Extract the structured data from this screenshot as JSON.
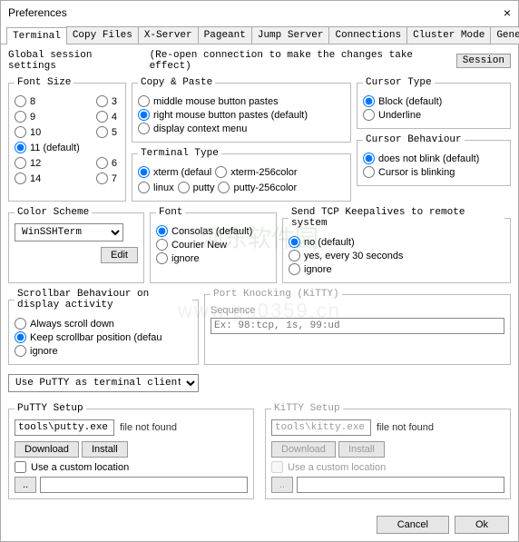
{
  "window": {
    "title": "Preferences",
    "close": "×"
  },
  "tabs": [
    "Terminal",
    "Copy Files",
    "X-Server",
    "Pageant",
    "Jump Server",
    "Connections",
    "Cluster Mode",
    "General"
  ],
  "activeTab": 0,
  "subtitle": {
    "label": "Global session settings",
    "hint": "(Re-open connection to make the changes take effect)",
    "sessionBtn": "Session"
  },
  "fontSize": {
    "legend": "Font Size",
    "left": [
      "8",
      "9",
      "10",
      "11 (default)",
      "12",
      "14"
    ],
    "right": [
      "3",
      "4",
      "5",
      "",
      "6",
      "7"
    ],
    "selected": "11 (default)"
  },
  "copyPaste": {
    "legend": "Copy & Paste",
    "options": [
      "middle mouse button pastes",
      "right mouse button pastes (default)",
      "display context menu"
    ],
    "selected": 1
  },
  "cursorType": {
    "legend": "Cursor Type",
    "options": [
      "Block (default)",
      "Underline"
    ],
    "selected": 0
  },
  "terminalType": {
    "legend": "Terminal Type",
    "row1": [
      "xterm (defaul",
      "xterm-256color"
    ],
    "row2": [
      "linux",
      "putty",
      "putty-256color"
    ],
    "selected": "xterm (defaul"
  },
  "cursorBehaviour": {
    "legend": "Cursor Behaviour",
    "options": [
      "does not blink (default)",
      "Cursor is blinking"
    ],
    "selected": 0
  },
  "colorScheme": {
    "legend": "Color Scheme",
    "value": "WinSSHTerm",
    "editBtn": "Edit"
  },
  "font": {
    "legend": "Font",
    "options": [
      "Consolas (default)",
      "Courier New",
      "ignore"
    ],
    "selected": 0
  },
  "keepalive": {
    "legend": "Send TCP Keepalives to remote system",
    "options": [
      "no (default)",
      "yes, every 30 seconds",
      "ignore"
    ],
    "selected": 0
  },
  "scrollbar": {
    "legend": "Scrollbar Behaviour on display activity",
    "options": [
      "Always scroll down",
      "Keep scrollbar position (defau",
      "ignore"
    ],
    "selected": 1
  },
  "portKnocking": {
    "legend": "Port Knocking (KiTTY)",
    "sub": "Sequence",
    "placeholder": "Ex: 98:tcp, 1s, 99:ud"
  },
  "clientDropdown": "Use PuTTY as terminal client (、",
  "puttySetup": {
    "legend": "PuTTY Setup",
    "path": "tools\\putty.exe",
    "notfound": "file not found",
    "download": "Download",
    "install": "Install",
    "customChk": "Use a custom location",
    "dots": ".."
  },
  "kittySetup": {
    "legend": "KiTTY Setup",
    "path": "tools\\kitty.exe",
    "notfound": "file not found",
    "download": "Download",
    "install": "Install",
    "customChk": "Use a custom location",
    "dots": ".."
  },
  "footer": {
    "cancel": "Cancel",
    "ok": "Ok"
  },
  "watermark": {
    "logo": "河东软件园",
    "url": "www.pc0359.cn"
  }
}
